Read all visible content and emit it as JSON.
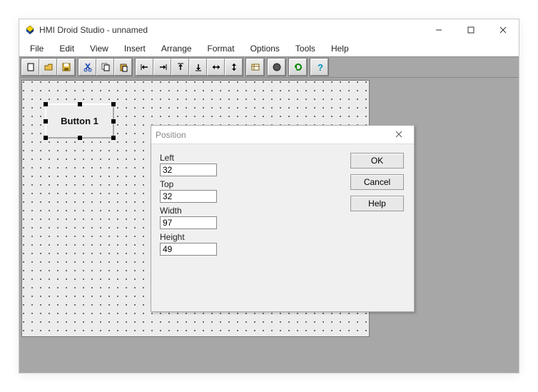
{
  "window": {
    "title": "HMI Droid Studio - unnamed"
  },
  "menu": {
    "file": "File",
    "edit": "Edit",
    "view": "View",
    "insert": "Insert",
    "arrange": "Arrange",
    "format": "Format",
    "options": "Options",
    "tools": "Tools",
    "help": "Help"
  },
  "canvas": {
    "button_label": "Button 1"
  },
  "dialog": {
    "title": "Position",
    "left_label": "Left",
    "left_value": "32",
    "top_label": "Top",
    "top_value": "32",
    "width_label": "Width",
    "width_value": "97",
    "height_label": "Height",
    "height_value": "49",
    "ok": "OK",
    "cancel": "Cancel",
    "help": "Help"
  }
}
